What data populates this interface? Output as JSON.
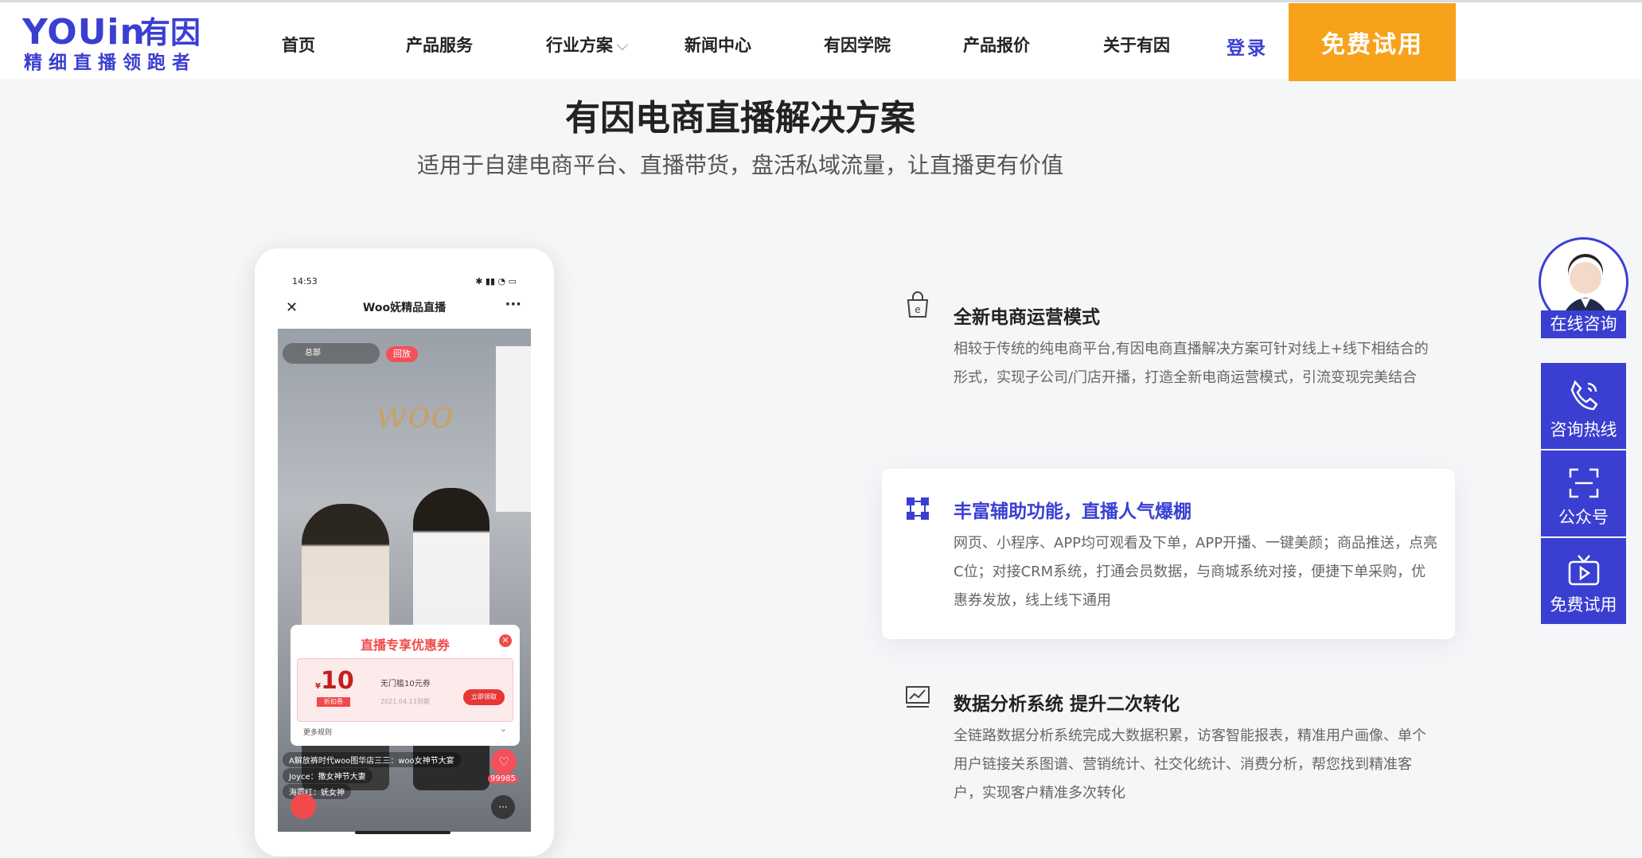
{
  "nav": {
    "logo_word": "YOUin",
    "logo_cn": "有因",
    "logo_sub": "精细直播领跑者",
    "items": [
      "首页",
      "产品服务",
      "行业方案",
      "新闻中心",
      "有因学院",
      "产品报价",
      "关于有因"
    ],
    "login": "登录",
    "trial": "免费试用"
  },
  "hero": {
    "title": "有因电商直播解决方案",
    "subtitle": "适用于自建电商平台、直播带货，盘活私域流量，让直播更有价值"
  },
  "phone": {
    "time": "14:53",
    "title": "Woo妩精品直播",
    "home_label": "总部",
    "replay": "回放",
    "coupon_title": "直播专享优惠券",
    "coupon_amount": "10",
    "coupon_currency": "¥",
    "coupon_tag": "折扣券",
    "coupon_name": "无门槛10元券",
    "coupon_date": "2021.04.11到期",
    "coupon_button": "立即领取",
    "coupon_more": "更多规则",
    "chats": [
      "A解放裤时代woo图华店三三：woo女神节大宴",
      "Joyce：撒女神节大妻",
      "海霞红：妩女神"
    ],
    "likes": "99985"
  },
  "features": [
    {
      "title": "全新电商运营模式",
      "desc": "相较于传统的纯电商平台,有因电商直播解决方案可针对线上+线下相结合的形式，实现子公司/门店开播，打造全新电商运营模式，引流变现完美结合"
    },
    {
      "title": "丰富辅助功能，直播人气爆棚",
      "desc": "网页、小程序、APP均可观看及下单，APP开播、一键美颜；商品推送，点亮C位；对接CRM系统，打通会员数据，与商城系统对接，便捷下单采购，优惠券发放，线上线下通用"
    },
    {
      "title": "数据分析系统 提升二次转化",
      "desc": "全链路数据分析系统完成大数据积累，访客智能报表，精准用户画像、单个用户链接关系图谱、营销统计、社交化统计、消费分析，帮您找到精准客户，实现客户精准多次转化"
    }
  ],
  "float": {
    "online": "在线咨询",
    "hotline": "咨询热线",
    "wechat": "公众号",
    "trial": "免费试用"
  },
  "colors": {
    "brand": "#3a3fd2",
    "accent": "#f7a21a"
  }
}
